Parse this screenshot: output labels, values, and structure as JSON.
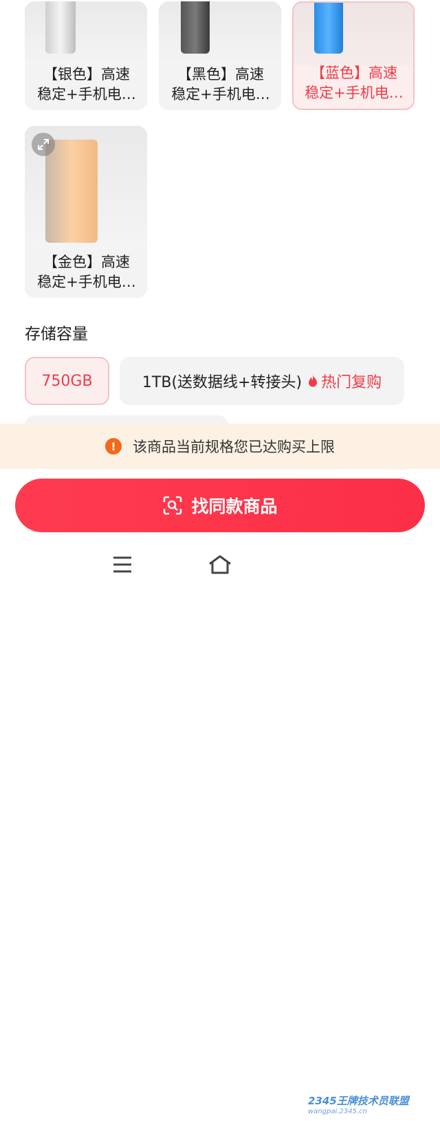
{
  "colors": {
    "accent": "#ef3b47",
    "button_bg": "#fb2f47",
    "notice_bg": "#fdf1e4",
    "warn": "#f06a1c"
  },
  "variants": [
    {
      "line1": "【银色】高速",
      "line2": "稳定+手机电…",
      "selected": false
    },
    {
      "line1": "【黑色】高速",
      "line2": "稳定+手机电…",
      "selected": false
    },
    {
      "line1": "【蓝色】高速",
      "line2": "稳定+手机电…",
      "selected": true
    },
    {
      "line1": "【金色】高速",
      "line2": "稳定+手机电…",
      "selected": false
    }
  ],
  "storage": {
    "title": "存储容量",
    "options": [
      {
        "label": "750GB",
        "selected": true
      },
      {
        "label": "1TB(送数据线+转接头)",
        "hot_label": "热门复购",
        "selected": false
      }
    ]
  },
  "notice": {
    "icon": "warning-icon",
    "text": "该商品当前规格您已达购买上限"
  },
  "find_button": {
    "icon": "scan-icon",
    "label": "找同款商品"
  },
  "nav": {
    "menu_icon": "menu-icon",
    "home_icon": "home-icon"
  },
  "watermark": {
    "line1": "2345王牌技术员联盟",
    "line2": "wangpai.2345.cn"
  }
}
